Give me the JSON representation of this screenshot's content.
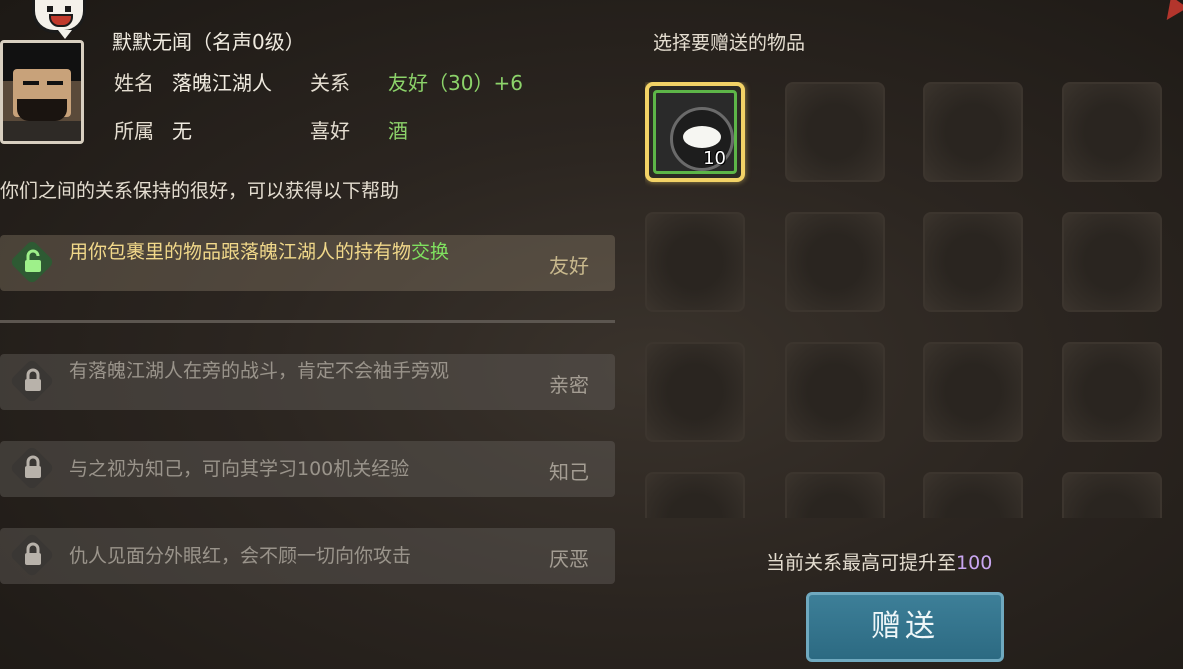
{
  "character": {
    "title": "默默无闻（名声0级）",
    "name_label": "姓名",
    "name": "落魄江湖人",
    "relation_label": "关系",
    "relation": "友好（30）+6",
    "faction_label": "所属",
    "faction": "无",
    "hobby_label": "喜好",
    "hobby": "酒"
  },
  "help_text": "你们之间的关系保持的很好，可以获得以下帮助",
  "perks": [
    {
      "text_main": "用你包裹里的物品跟落魄江湖人的持有物",
      "text_highlight": "交换",
      "tag": "友好",
      "status": "unlocked"
    },
    {
      "text_main": "有落魄江湖人在旁的战斗，肯定不会袖手旁观",
      "tag": "亲密",
      "status": "locked"
    },
    {
      "text_main": "与之视为知己，可向其学习100机关经验",
      "tag": "知己",
      "status": "locked"
    },
    {
      "text_main": "仇人见面分外眼红，会不顾一切向你攻击",
      "tag": "厌恶",
      "status": "locked"
    }
  ],
  "gift_panel": {
    "title": "选择要赠送的物品",
    "items": [
      {
        "name": "rice-bowl",
        "count": "10",
        "selected": true
      }
    ],
    "max_text": "当前关系最高可提升至",
    "max_value": "100",
    "button_label": "赠送"
  },
  "colors": {
    "highlight_green": "#8cd36a",
    "gold_text": "#f1d88a",
    "max_value": "#c9a6f0",
    "button": "#3d7f98"
  }
}
